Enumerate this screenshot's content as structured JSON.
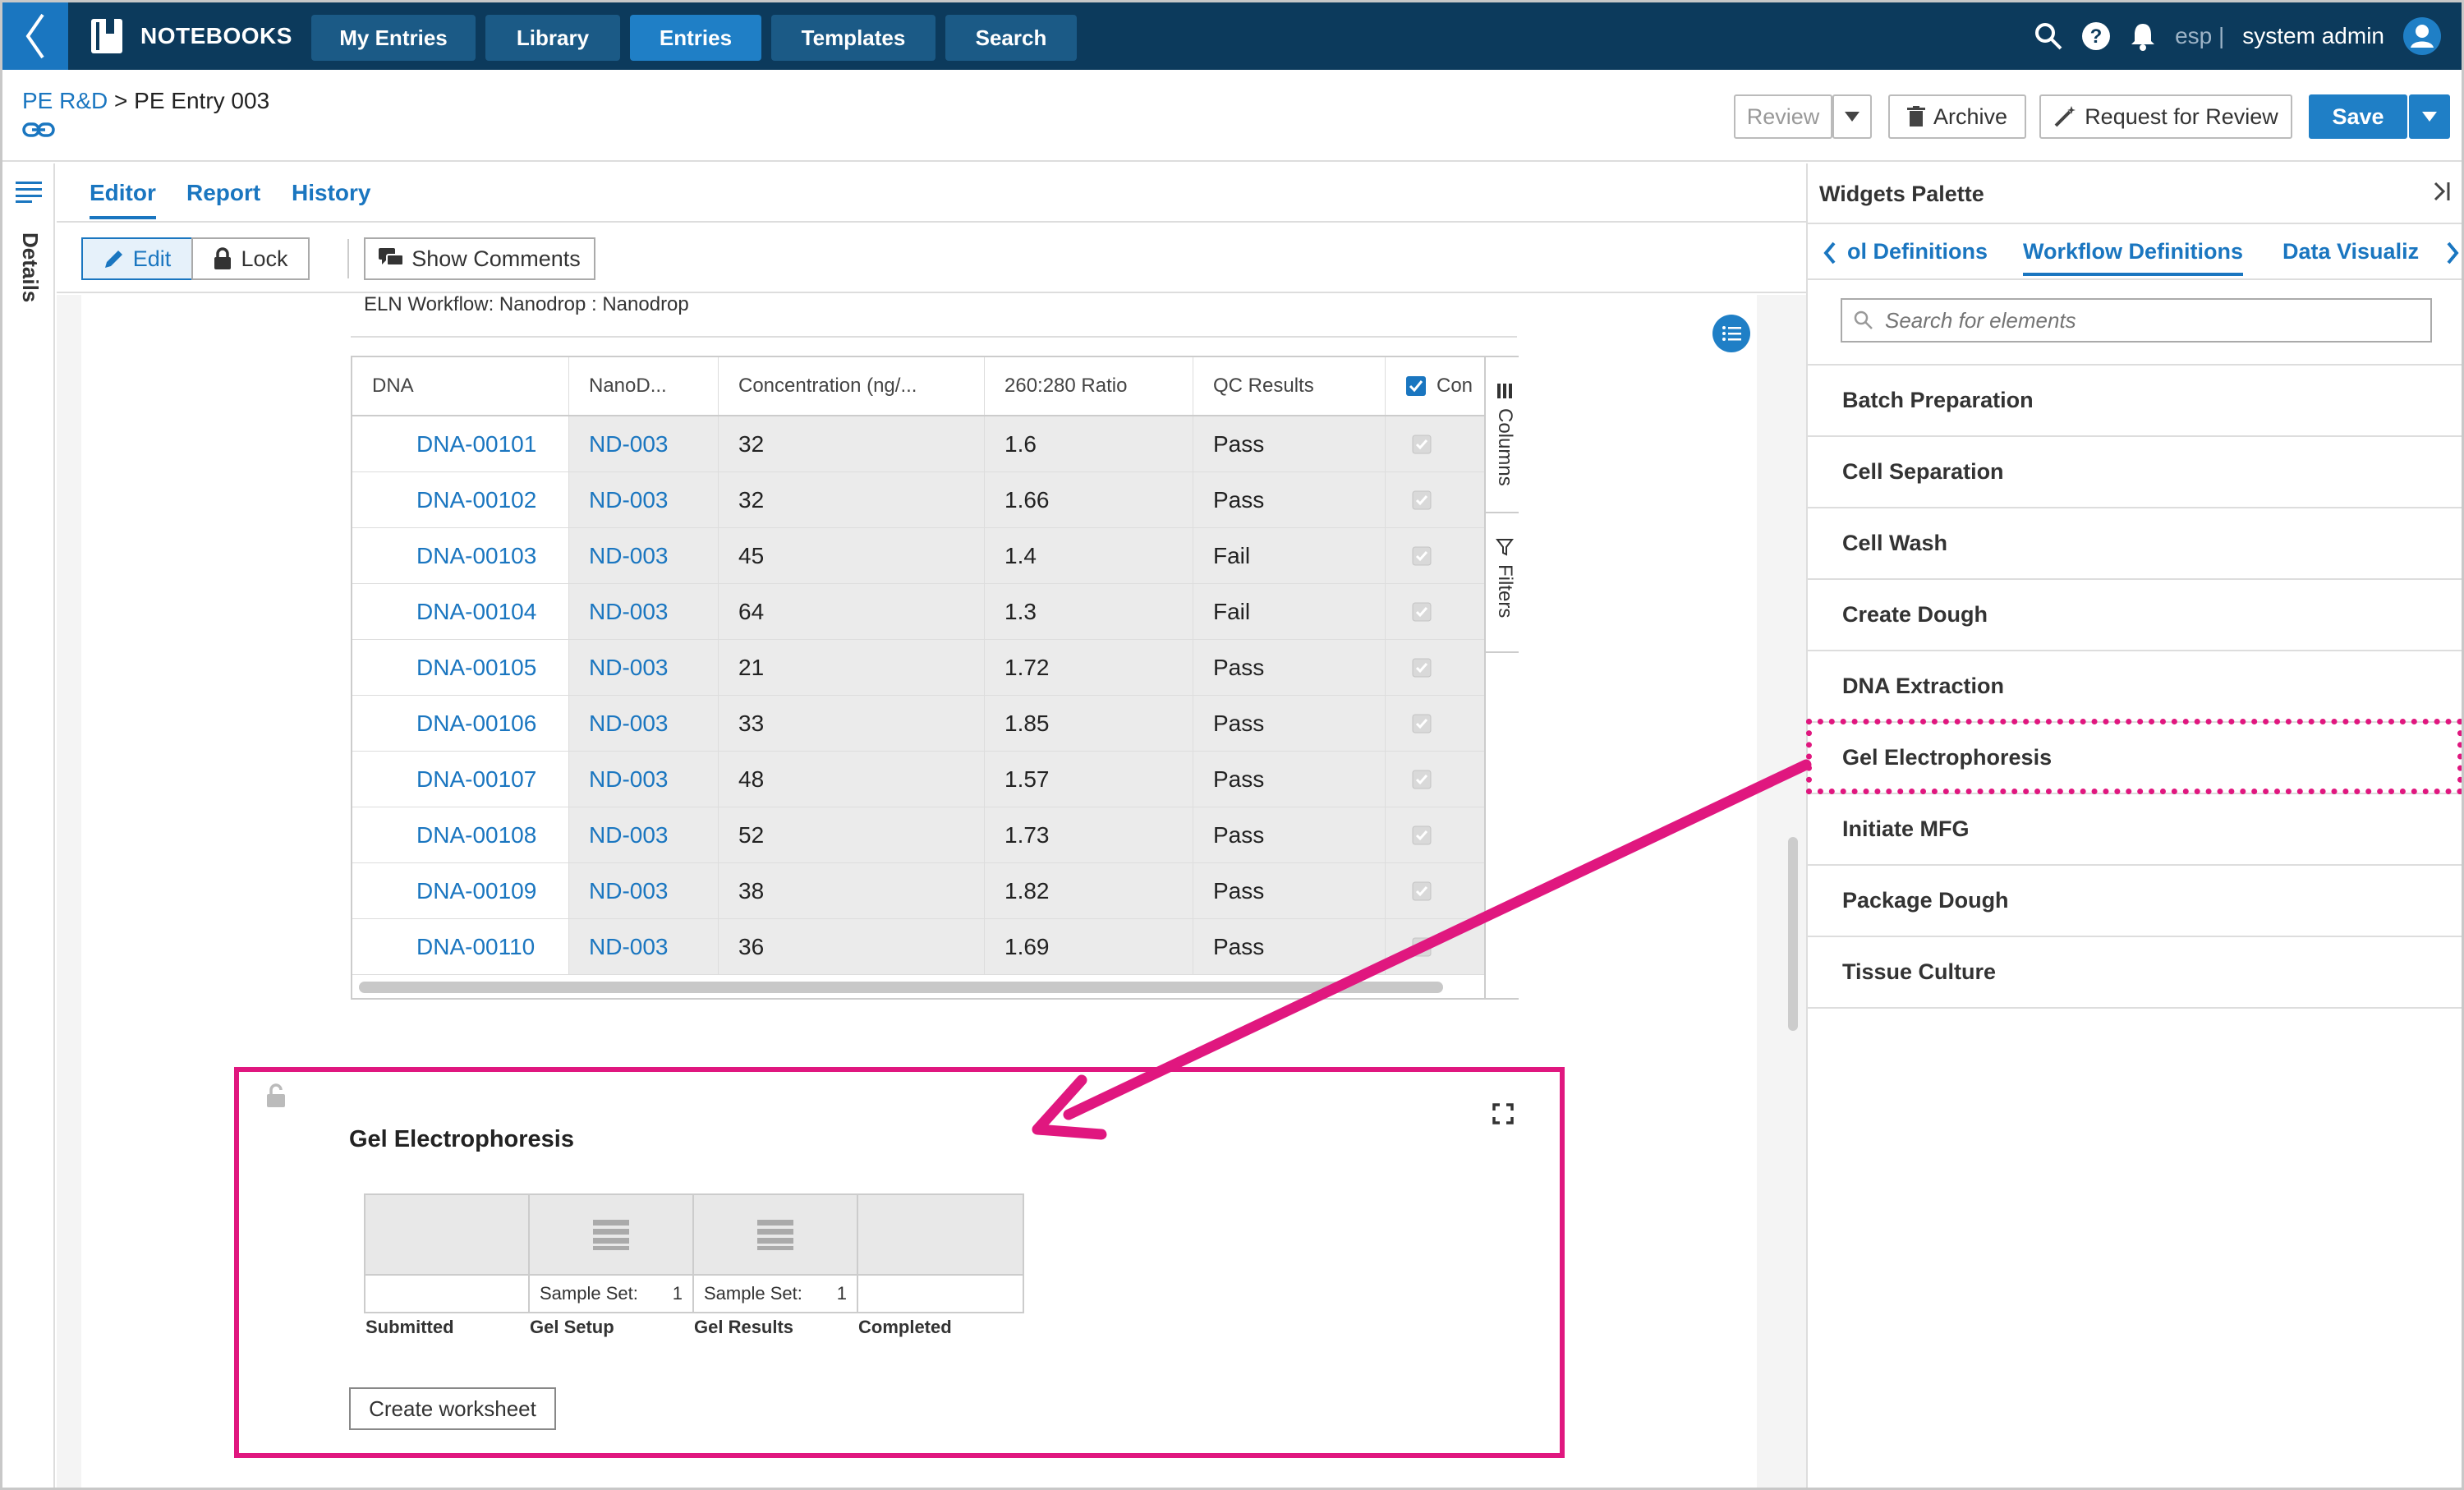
{
  "nav": {
    "brand": "NOTEBOOKS",
    "items": [
      {
        "label": "My Entries"
      },
      {
        "label": "Library"
      },
      {
        "label": "Entries"
      },
      {
        "label": "Templates"
      },
      {
        "label": "Search"
      }
    ],
    "active": "Entries",
    "lang": "esp |",
    "user": "system admin"
  },
  "header": {
    "breadcrumb_parent": "PE R&D",
    "breadcrumb_sep": ">",
    "breadcrumb_current": "PE Entry 003",
    "review_label": "Review",
    "archive_label": "Archive",
    "request_review_label": "Request for Review",
    "save_label": "Save"
  },
  "left_strip": {
    "details_label": "Details"
  },
  "tabs": [
    {
      "label": "Editor"
    },
    {
      "label": "Report"
    },
    {
      "label": "History"
    }
  ],
  "toolbar": {
    "edit_label": "Edit",
    "lock_label": "Lock",
    "show_comments_label": "Show Comments"
  },
  "workflow_label": "ELN Workflow: Nanodrop : Nanodrop",
  "grid": {
    "columns": [
      "DNA",
      "NanoD...",
      "Concentration (ng/...",
      "260:280 Ratio",
      "QC Results",
      "Con"
    ],
    "rows": [
      {
        "dna": "DNA-00101",
        "nano": "ND-003",
        "conc": "32",
        "ratio": "1.6",
        "qc": "Pass"
      },
      {
        "dna": "DNA-00102",
        "nano": "ND-003",
        "conc": "32",
        "ratio": "1.66",
        "qc": "Pass"
      },
      {
        "dna": "DNA-00103",
        "nano": "ND-003",
        "conc": "45",
        "ratio": "1.4",
        "qc": "Fail"
      },
      {
        "dna": "DNA-00104",
        "nano": "ND-003",
        "conc": "64",
        "ratio": "1.3",
        "qc": "Fail"
      },
      {
        "dna": "DNA-00105",
        "nano": "ND-003",
        "conc": "21",
        "ratio": "1.72",
        "qc": "Pass"
      },
      {
        "dna": "DNA-00106",
        "nano": "ND-003",
        "conc": "33",
        "ratio": "1.85",
        "qc": "Pass"
      },
      {
        "dna": "DNA-00107",
        "nano": "ND-003",
        "conc": "48",
        "ratio": "1.57",
        "qc": "Pass"
      },
      {
        "dna": "DNA-00108",
        "nano": "ND-003",
        "conc": "52",
        "ratio": "1.73",
        "qc": "Pass"
      },
      {
        "dna": "DNA-00109",
        "nano": "ND-003",
        "conc": "38",
        "ratio": "1.82",
        "qc": "Pass"
      },
      {
        "dna": "DNA-00110",
        "nano": "ND-003",
        "conc": "36",
        "ratio": "1.69",
        "qc": "Pass"
      }
    ],
    "side_columns_label": "Columns",
    "side_filters_label": "Filters"
  },
  "widget": {
    "title": "Gel Electrophoresis",
    "stages": [
      {
        "name": "Submitted",
        "sample_label": "",
        "count": ""
      },
      {
        "name": "Gel Setup",
        "sample_label": "Sample Set:",
        "count": "1"
      },
      {
        "name": "Gel Results",
        "sample_label": "Sample Set:",
        "count": "1"
      },
      {
        "name": "Completed",
        "sample_label": "",
        "count": ""
      }
    ],
    "create_worksheet_label": "Create worksheet"
  },
  "palette": {
    "title": "Widgets Palette",
    "tabs": [
      {
        "label": "ol Definitions"
      },
      {
        "label": "Workflow Definitions"
      },
      {
        "label": "Data Visualiz"
      }
    ],
    "search_placeholder": "Search for elements",
    "items": [
      {
        "label": "Batch Preparation"
      },
      {
        "label": "Cell Separation"
      },
      {
        "label": "Cell Wash"
      },
      {
        "label": "Create Dough"
      },
      {
        "label": "DNA Extraction"
      },
      {
        "label": "Gel Electrophoresis"
      },
      {
        "label": "Initiate MFG"
      },
      {
        "label": "Package Dough"
      },
      {
        "label": "Tissue Culture"
      }
    ]
  },
  "colors": {
    "nav_bg": "#0c3a5c",
    "accent": "#1f7fc6",
    "highlight": "#e0177f"
  }
}
